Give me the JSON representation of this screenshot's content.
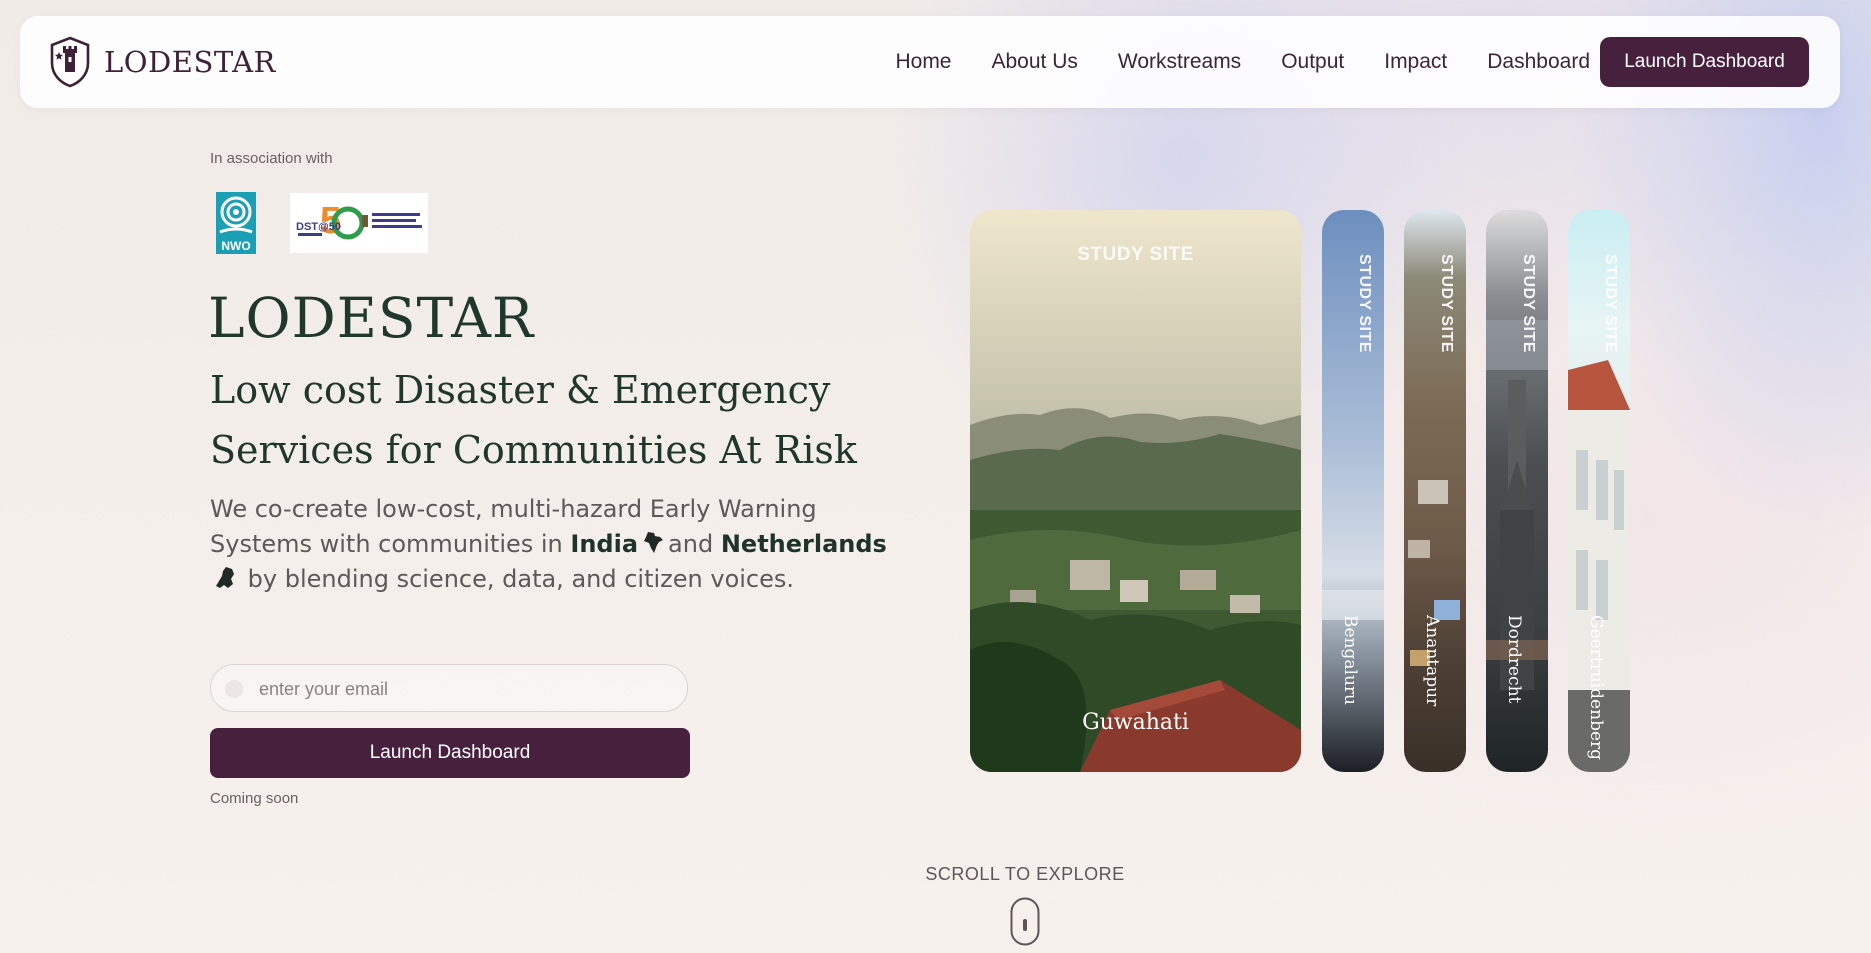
{
  "nav": {
    "logo_text": "LODESTAR",
    "links": [
      "Home",
      "About Us",
      "Workstreams",
      "Output",
      "Impact",
      "Dashboard"
    ],
    "cta_label": "Launch Dashboard"
  },
  "hero": {
    "association_label": "In association with",
    "partners": {
      "nwo_text": "NWO",
      "dst_text": "DST@50"
    },
    "title": "LODESTAR",
    "subtitle": "Low cost Disaster & Emergency Services for Communities At Risk",
    "desc_part1": "We co-create low-cost, multi-hazard Early Warning Systems with communities in",
    "desc_india": "India",
    "desc_and": "and",
    "desc_netherlands": "Netherlands",
    "desc_part2": "by blending science, data, and citizen voices.",
    "email_placeholder": "enter your email",
    "cta_label": "Launch Dashboard",
    "coming_soon": "Coming soon"
  },
  "sites": {
    "caption": "STUDY SITE",
    "main": "Guwahati",
    "others": [
      "Bengaluru",
      "Anantapur",
      "Dordrecht",
      "Geertruidenberg"
    ]
  },
  "scroll": {
    "label": "SCROLL TO EXPLORE"
  },
  "colors": {
    "brand": "#46203d",
    "heading": "#20382b",
    "body": "#5e5858"
  }
}
